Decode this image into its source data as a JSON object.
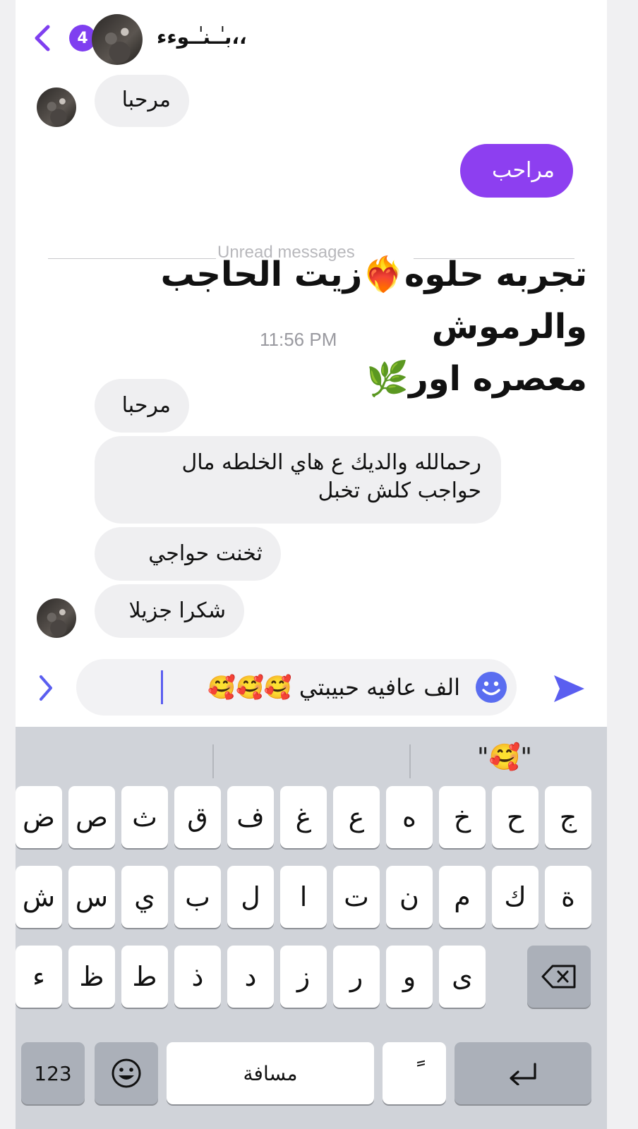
{
  "header": {
    "badge_count": "4",
    "contact_name": "بـٰـنـٰـوءء،،"
  },
  "messages": [
    {
      "text": "مرحبا"
    },
    {
      "text": "مراحب"
    },
    {
      "text": "مرحبا"
    },
    {
      "text_line1": "رحمالله والديك ع هاي الخلطه مال",
      "text_line2": "حواجب كلش تخبل"
    },
    {
      "text": "ثخنت حواجي"
    },
    {
      "text": "شكرا جزيلا"
    }
  ],
  "divider": {
    "label": "Unread messages"
  },
  "timestamp": "11:56 PM",
  "overlay": {
    "line1": "تجربه حلوه❤️‍🔥زيت الحاجب",
    "line2": "والرموش",
    "line3": "معصره اور🌿"
  },
  "composer": {
    "text": "الف عافيه حبيبتي 🥰🥰🥰"
  },
  "keyboard": {
    "suggestion": "\"🥰\"",
    "row1": [
      "ج",
      "ح",
      "خ",
      "ه",
      "ع",
      "غ",
      "ف",
      "ق",
      "ث",
      "ص",
      "ض"
    ],
    "row2": [
      "ة",
      "ك",
      "م",
      "ن",
      "ت",
      "ا",
      "ل",
      "ب",
      "ي",
      "س",
      "ش"
    ],
    "row3": [
      "ى",
      "و",
      "ر",
      "ز",
      "د",
      "ذ",
      "ط",
      "ظ",
      "ء"
    ],
    "numbers_label": "123",
    "space_label": "مسافة",
    "diacritic_label": "ً"
  },
  "colors": {
    "accent": "#8d3ff0",
    "badge": "#7f3ff0",
    "send": "#5a5ef0"
  }
}
